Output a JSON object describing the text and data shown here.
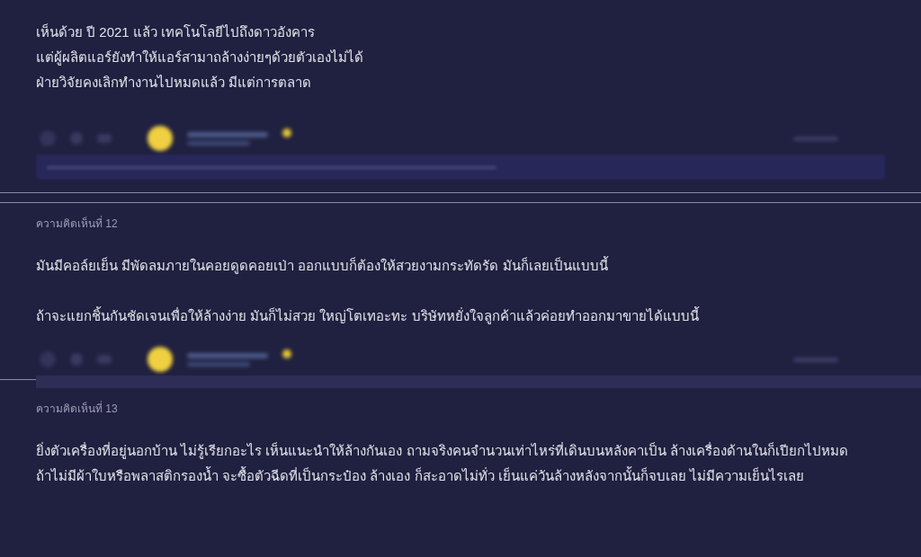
{
  "reply_tail": {
    "lines": [
      "เห็นด้วย ปี 2021 แล้ว เทคโนโลยีไปถึงดาวอังคาร",
      "แต่ผู้ผลิตแอร์ยังทำให้แอร์สามาถล้างง่ายๆด้วยตัวเองไม่ได้",
      "ฝ่ายวิจัยคงเลิกทำงานไปหมดแล้ว มีแต่การตลาด"
    ]
  },
  "comments": [
    {
      "label": "ความคิดเห็นที่ 12",
      "paragraphs": [
        "มันมีคอล์ยเย็น มีพัดลมภายในคอยดูดคอยเป่า ออกแบบก็ต้องให้สวยงามกระทัดรัด มันก็เลยเป็นแบบนี้",
        "ถ้าจะแยกชิ้นกันชัดเจนเพื่อให้ล้างง่าย มันก็ไม่สวย ใหญ่โตเทอะทะ บริษัทหยั่งใจลูกค้าแล้วค่อยทำออกมาขายได้แบบนี้"
      ]
    },
    {
      "label": "ความคิดเห็นที่ 13",
      "paragraphs": [
        "ยิ่งตัวเครื่องที่อยู่นอกบ้าน ไม่รู้เรียกอะไร เห็นแนะนำให้ล้างกันเอง ถามจริงคนจำนวนเท่าไหร่ที่เดินบนหลังคาเป็น ล้างเครื่องด้านในก็เปียกไปหมด ถ้าไม่มีผ้าใบหรือพลาสติกรองน้ำ จะซื้อตัวฉีดที่เป็นกระป๋อง ล้างเอง ก็สะอาดไม่ทั่ว เย็นแค่วันล้างหลังจากนั้นก็จบเลย ไม่มีความเย็นไรเลย"
      ]
    }
  ]
}
